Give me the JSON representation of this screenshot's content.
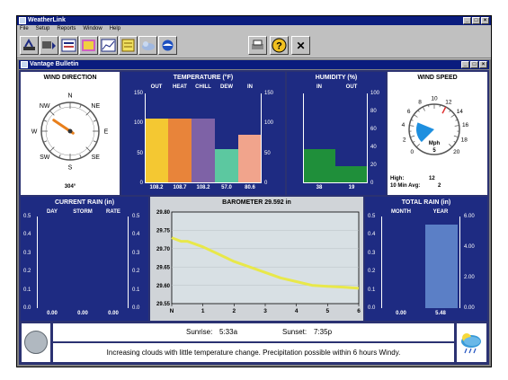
{
  "app": {
    "title": "WeatherLink"
  },
  "menu": [
    "File",
    "Setup",
    "Reports",
    "Window",
    "Help"
  ],
  "toolbar": {
    "icons": [
      "station-icon",
      "download-icon",
      "data-icon",
      "bulletin-icon",
      "graph-icon",
      "notes-icon",
      "weather-icon",
      "noaa-icon",
      "print-icon",
      "help-icon",
      "close-icon"
    ],
    "help_glyph": "?",
    "close_glyph": "✕"
  },
  "window": {
    "title": "Vantage Bulletin"
  },
  "wind_direction": {
    "title": "WIND DIRECTION",
    "degrees": 304,
    "readout": "304°",
    "compass": [
      "N",
      "NE",
      "E",
      "SE",
      "S",
      "SW",
      "W",
      "NW"
    ]
  },
  "temperature": {
    "title": "TEMPERATURE (°F)",
    "columns": [
      "OUT",
      "HEAT",
      "CHILL",
      "DEW",
      "IN"
    ],
    "values": [
      108.2,
      108.7,
      108.2,
      57.0,
      80.6
    ],
    "value_labels": [
      "108.2",
      "108.7",
      "108.2",
      "57.0",
      "80.6"
    ],
    "colors": [
      "#f4c832",
      "#e8843a",
      "#7e62a6",
      "#5cc8a0",
      "#f1a48c"
    ],
    "ticks": [
      "150",
      "100",
      "50",
      "0"
    ],
    "ylim": [
      0,
      150
    ]
  },
  "humidity": {
    "title": "HUMIDITY (%)",
    "columns": [
      "IN",
      "OUT"
    ],
    "values": [
      38,
      19
    ],
    "value_labels": [
      "38",
      "19"
    ],
    "color": "#1f8f3a",
    "ticks": [
      "100",
      "80",
      "60",
      "40",
      "20",
      "0"
    ],
    "ylim": [
      0,
      100
    ]
  },
  "wind_speed": {
    "title": "WIND SPEED",
    "speed": 5,
    "speed_label": "5",
    "unit": "Mph",
    "dial_ticks": [
      "0",
      "2",
      "4",
      "6",
      "8",
      "10",
      "12",
      "14",
      "16",
      "18",
      "20"
    ],
    "high_label": "High:",
    "high_value": "12",
    "avg_label": "10 Min Avg:",
    "avg_value": "2"
  },
  "current_rain": {
    "title": "CURRENT RAIN (in)",
    "columns": [
      "DAY",
      "STORM",
      "RATE"
    ],
    "values": [
      "0.00",
      "0.00",
      "0.00"
    ],
    "ticks": [
      "0.5",
      "0.4",
      "0.3",
      "0.2",
      "0.1",
      "0.0"
    ]
  },
  "barometer": {
    "title": "BAROMETER 29.592 in",
    "y_ticks": [
      "29.80",
      "29.75",
      "29.70",
      "29.65",
      "29.60",
      "29.55"
    ],
    "x_ticks": [
      "N",
      "1",
      "2",
      "3",
      "4",
      "5",
      "6"
    ],
    "color": "#e8e84a"
  },
  "total_rain": {
    "title": "TOTAL RAIN (in)",
    "columns": [
      "MONTH",
      "YEAR"
    ],
    "values": [
      "0.00",
      "5.48"
    ],
    "year_value": 5.48,
    "left_ticks": [
      "0.5",
      "0.4",
      "0.3",
      "0.2",
      "0.1",
      "0.0"
    ],
    "right_ticks": [
      "6.00",
      "4.00",
      "2.00",
      "0.00"
    ],
    "bar_color": "#5b7fc6"
  },
  "forecast": {
    "sunrise_label": "Sunrise:",
    "sunrise": "5:33a",
    "sunset_label": "Sunset:",
    "sunset": "7:35p",
    "text": "Increasing clouds with little temperature change.  Precipitation possible within 6 hours  Windy."
  },
  "chart_data": [
    {
      "type": "bar",
      "title": "TEMPERATURE (°F)",
      "categories": [
        "OUT",
        "HEAT",
        "CHILL",
        "DEW",
        "IN"
      ],
      "values": [
        108.2,
        108.7,
        108.2,
        57.0,
        80.6
      ],
      "ylim": [
        0,
        150
      ]
    },
    {
      "type": "bar",
      "title": "HUMIDITY (%)",
      "categories": [
        "IN",
        "OUT"
      ],
      "values": [
        38,
        19
      ],
      "ylim": [
        0,
        100
      ]
    },
    {
      "type": "bar",
      "title": "TOTAL RAIN (in)",
      "categories": [
        "MONTH",
        "YEAR"
      ],
      "values": [
        0.0,
        5.48
      ],
      "ylim": [
        0,
        6
      ]
    },
    {
      "type": "line",
      "title": "BAROMETER 29.592 in",
      "x": [
        0,
        0.3,
        0.5,
        1,
        1.5,
        2,
        2.5,
        3,
        3.5,
        4,
        4.5,
        5,
        5.5,
        6
      ],
      "y": [
        29.73,
        29.72,
        29.72,
        29.705,
        29.685,
        29.665,
        29.65,
        29.635,
        29.62,
        29.61,
        29.6,
        29.597,
        29.595,
        29.592
      ],
      "xlim": [
        0,
        6
      ],
      "ylim": [
        29.55,
        29.8
      ]
    }
  ]
}
